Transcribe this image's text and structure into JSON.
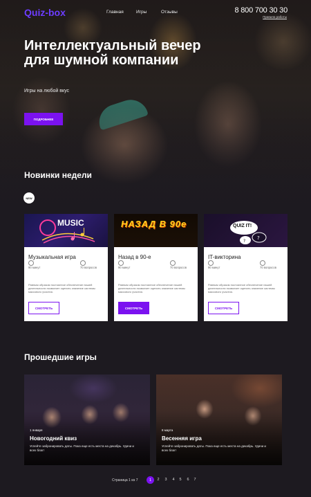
{
  "nav": {
    "logo": "Quiz-box",
    "items": [
      "Главная",
      "Игры",
      "Отзывы"
    ],
    "phone": "8 800 700 30 30",
    "rules_link": "Правила работы"
  },
  "hero": {
    "title": "Интеллектуальный вечер для шумной компании",
    "subtitle": "Игры на любой вкус",
    "button": "ПОДРОБНЕЕ"
  },
  "weekly": {
    "title": "Новинки недели",
    "badge": "NEW",
    "cards": [
      {
        "image_text": "MUSIC",
        "title": "Музыкальная игра",
        "duration": "90 минут",
        "questions": "70 вопросов",
        "description": "Равным образом постоянное обеспечение нашей деятельности позволяет оценить значение системы массового участия.",
        "button": "СМОТРЕТЬ"
      },
      {
        "image_text": "НАЗАД В 90е",
        "title": "Назад в 90-е",
        "duration": "90 минут",
        "questions": "70 вопросов",
        "description": "Равным образом постоянное обеспечение нашей деятельности позволяет оценить значение системы массового участия.",
        "button": "СМОТРЕТЬ"
      },
      {
        "image_text": "QUIZ IT!",
        "title": "IT-викторина",
        "duration": "90 минут",
        "questions": "70 вопросов",
        "description": "Равным образом постоянное обеспечение нашей деятельности позволяет оценить значение системы массового участия.",
        "button": "СМОТРЕТЬ"
      }
    ]
  },
  "past": {
    "title": "Прошедшие игры",
    "items": [
      {
        "date": "1 января",
        "title": "Новогодний квиз",
        "description": "Успейте забронировать даты. Пока еще есть места на декабрь. Удачи и всех благ!"
      },
      {
        "date": "8 марта",
        "title": "Весенняя игра",
        "description": "Успейте забронировать даты. Пока еще есть места на декабрь. Удачи и всех благ!"
      }
    ]
  },
  "pagination": {
    "label": "Страница 1 из 7",
    "pages": [
      "1",
      "2",
      "3",
      "4",
      "5",
      "6",
      "7"
    ],
    "current": "1"
  },
  "colors": {
    "accent": "#7b12f0",
    "logo": "#6c3cff",
    "background": "#1d1a20"
  }
}
